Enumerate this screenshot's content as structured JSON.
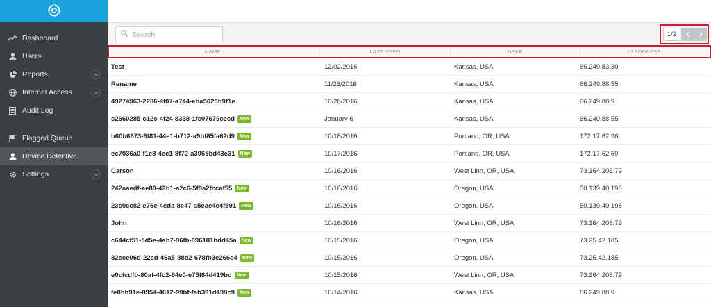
{
  "sidebar": {
    "logo": "lifebuoy-logo-icon",
    "items": [
      {
        "label": "Dashboard",
        "icon": "chart-line-icon",
        "expandable": false,
        "active": false
      },
      {
        "label": "Users",
        "icon": "user-icon",
        "expandable": false,
        "active": false
      },
      {
        "label": "Reports",
        "icon": "pie-chart-icon",
        "expandable": true,
        "active": false
      },
      {
        "label": "Internet Access",
        "icon": "globe-icon",
        "expandable": true,
        "active": false
      },
      {
        "label": "Audit Log",
        "icon": "list-icon",
        "expandable": false,
        "active": false
      },
      {
        "label": "Flagged Queue",
        "icon": "flag-icon",
        "expandable": false,
        "active": false
      },
      {
        "label": "Device Detective",
        "icon": "user-icon",
        "expandable": false,
        "active": true
      },
      {
        "label": "Settings",
        "icon": "gear-icon",
        "expandable": true,
        "active": false
      }
    ]
  },
  "search": {
    "placeholder": "Search",
    "value": ""
  },
  "pager": {
    "label": "1/2"
  },
  "table": {
    "columns": [
      "NAME ↓",
      "LAST SEEN",
      "NEAR",
      "IP ADDRESS"
    ],
    "badge_label": "New",
    "rows": [
      {
        "name": "Test",
        "new": false,
        "last_seen": "12/02/2016",
        "near": "Kansas, USA",
        "ip": "66.249.83.30"
      },
      {
        "name": "Rename",
        "new": false,
        "last_seen": "11/26/2016",
        "near": "Kansas, USA",
        "ip": "66.249.88.55"
      },
      {
        "name": "49274963-2286-4f07-a744-eba5025b9f1e",
        "new": false,
        "last_seen": "10/28/2016",
        "near": "Kansas, USA",
        "ip": "66.249.88.9"
      },
      {
        "name": "c2660285-c12c-4f24-8338-1fc07679cecd",
        "new": true,
        "last_seen": "January 6",
        "near": "Kansas, USA",
        "ip": "66.249.88.55"
      },
      {
        "name": "b60b6673-9f81-44e1-b712-a9bf85fa62d9",
        "new": true,
        "last_seen": "10/18/2016",
        "near": "Portland, OR, USA",
        "ip": "172.17.62.96"
      },
      {
        "name": "ec7036a0-f1e8-4ee1-8f72-a3065bd43c31",
        "new": true,
        "last_seen": "10/17/2016",
        "near": "Portland, OR, USA",
        "ip": "172.17.62.59"
      },
      {
        "name": "Carson",
        "new": false,
        "last_seen": "10/16/2016",
        "near": "West Linn, OR, USA",
        "ip": "73.164.208.79"
      },
      {
        "name": "242aaedf-ee80-42b1-a2c6-5f9a2fccaf55",
        "new": true,
        "last_seen": "10/16/2016",
        "near": "Oregon, USA",
        "ip": "50.139.40.198"
      },
      {
        "name": "23c0cc82-e76e-4eda-8e47-a5eae4e4f591",
        "new": true,
        "last_seen": "10/16/2016",
        "near": "Oregon, USA",
        "ip": "50.139.40.198"
      },
      {
        "name": "John",
        "new": false,
        "last_seen": "10/16/2016",
        "near": "West Linn, OR, USA",
        "ip": "73.164.208.79"
      },
      {
        "name": "c644cf51-5d5e-4ab7-96fb-096181bdd45a",
        "new": true,
        "last_seen": "10/15/2016",
        "near": "Oregon, USA",
        "ip": "73.25.42.185"
      },
      {
        "name": "32cce06d-22cd-46a5-88d2-678fb3e266e4",
        "new": true,
        "last_seen": "10/15/2016",
        "near": "Oregon, USA",
        "ip": "73.25.42.185"
      },
      {
        "name": "e0cfcdfb-80af-4fc2-94e0-e75f84d419bd",
        "new": true,
        "last_seen": "10/15/2016",
        "near": "West Linn, OR, USA",
        "ip": "73.164.208.79"
      },
      {
        "name": "fe0bb91e-8954-4612-99bf-fab391d499c9",
        "new": true,
        "last_seen": "10/14/2016",
        "near": "Kansas, USA",
        "ip": "66.249.88.9"
      }
    ]
  },
  "colors": {
    "brand": "#1aa2dc",
    "sidebar": "#3b3e42",
    "badge": "#7cb82f",
    "highlight": "#c8202a"
  }
}
